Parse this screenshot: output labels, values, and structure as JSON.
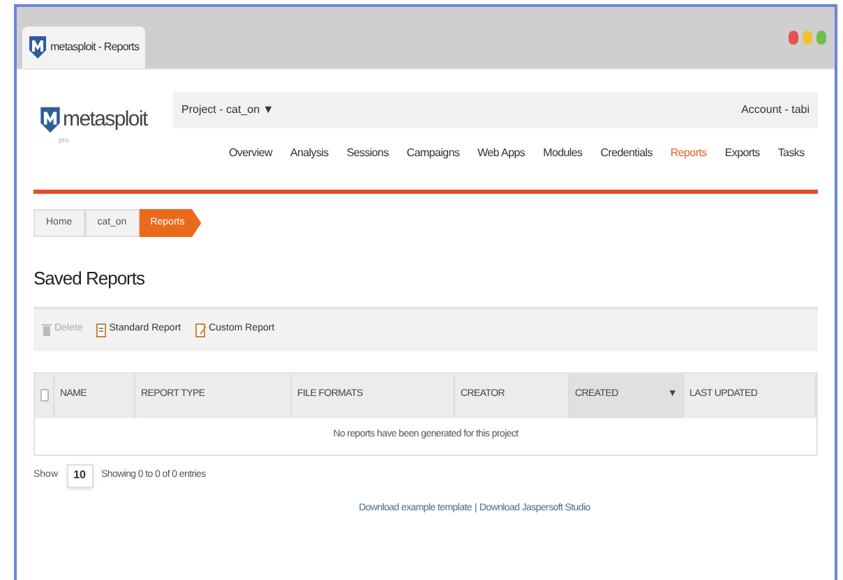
{
  "browser_tab": {
    "title": "metasploit - Reports"
  },
  "header": {
    "logo": "metasploit",
    "logo_sub": "pro",
    "project": "Project - cat_on",
    "project_caret": "▼",
    "account": "Account - tabi"
  },
  "nav": [
    {
      "label": "Overview",
      "selected": false
    },
    {
      "label": "Analysis",
      "selected": false
    },
    {
      "label": "Sessions",
      "selected": false
    },
    {
      "label": "Campaigns",
      "selected": false
    },
    {
      "label": "Web Apps",
      "selected": false
    },
    {
      "label": "Modules",
      "selected": false
    },
    {
      "label": "Credentials",
      "selected": false
    },
    {
      "label": "Reports",
      "selected": true
    },
    {
      "label": "Exports",
      "selected": false
    },
    {
      "label": "Tasks",
      "selected": false
    }
  ],
  "breadcrumb": [
    {
      "label": "Home",
      "selected": false
    },
    {
      "label": "cat_on",
      "selected": false
    },
    {
      "label": "Reports",
      "selected": true
    }
  ],
  "page_title": "Saved Reports",
  "toolbar": [
    {
      "label": "Delete",
      "kind": "delete",
      "disabled": true
    },
    {
      "label": "Standard Report",
      "kind": "standard",
      "disabled": false
    },
    {
      "label": "Custom Report",
      "kind": "custom",
      "disabled": false
    }
  ],
  "table": {
    "select_all": {
      "checked": false
    },
    "columns": [
      {
        "label": "NAME",
        "sorted": false
      },
      {
        "label": "REPORT TYPE",
        "sorted": false
      },
      {
        "label": "FILE FORMATS",
        "sorted": false
      },
      {
        "label": "CREATOR",
        "sorted": false
      },
      {
        "label": "CREATED",
        "sorted": true,
        "sort_icon": "▼"
      },
      {
        "label": "LAST UPDATED",
        "sorted": false
      }
    ],
    "empty_message": "No reports have been generated for this project"
  },
  "pagination": {
    "show_label": "Show",
    "page_size": "10",
    "info": "Showing 0 to 0 of 0 entries"
  },
  "footer_links": [
    "Download example template",
    "Download Jaspersoft Studio"
  ],
  "footer_separator": "|"
}
